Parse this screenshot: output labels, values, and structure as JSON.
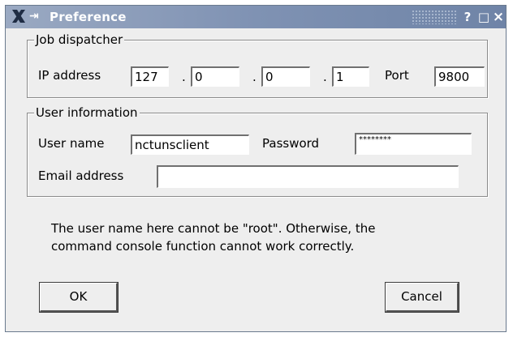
{
  "window": {
    "title": "Preference",
    "help_label": "?",
    "maximize_label": "□",
    "close_label": "×"
  },
  "job_dispatcher": {
    "legend": "Job dispatcher",
    "ip_label": "IP address",
    "ip_octets": [
      "127",
      "0",
      "0",
      "1"
    ],
    "dot": ".",
    "port_label": "Port",
    "port_value": "9800"
  },
  "user_information": {
    "legend": "User information",
    "username_label": "User name",
    "username_value": "nctunsclient",
    "password_label": "Password",
    "password_value": "********",
    "email_label": "Email address",
    "email_value": ""
  },
  "note": {
    "line1": "The user name here cannot be \"root\". Otherwise, the",
    "line2": "command console function cannot work correctly."
  },
  "buttons": {
    "ok": "OK",
    "cancel": "Cancel"
  }
}
